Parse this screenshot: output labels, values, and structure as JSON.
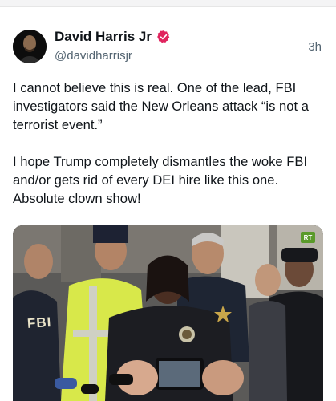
{
  "tweet": {
    "display_name": "David Harris Jr",
    "handle": "@davidharrisjr",
    "timestamp": "3h",
    "paragraph_1": "I cannot believe this is real. One of the lead, FBI investigators said the New Orleans attack “is not a terrorist event.”",
    "paragraph_2": "I hope Trump completely dismantles the woke FBI and/or gets rid of every DEI hire like this one. Absolute clown show!"
  },
  "media": {
    "corner_badge": "RT",
    "jacket_text": "FBI"
  },
  "icons": {
    "verified": "verified-badge-icon",
    "avatar": "profile-avatar"
  },
  "colors": {
    "verified_badge": "#e0245e",
    "secondary_text": "#536471",
    "primary_text": "#0f1419"
  }
}
